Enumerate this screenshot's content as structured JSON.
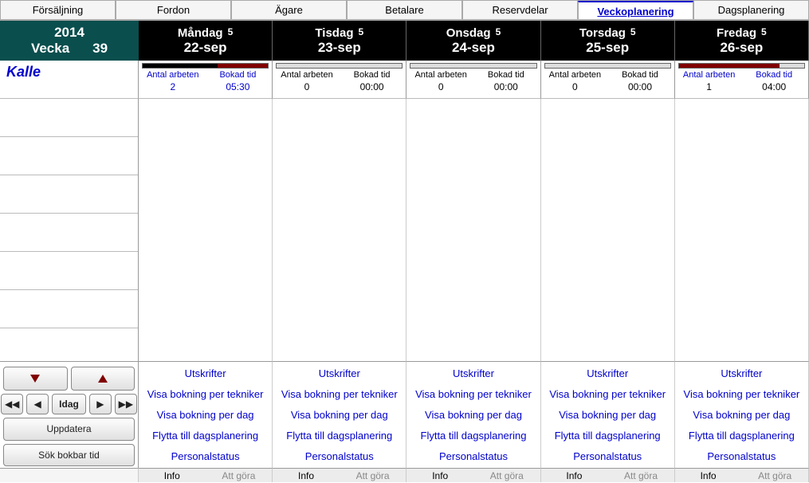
{
  "tabs": {
    "sales": "Försäljning",
    "vehicle": "Fordon",
    "owner": "Ägare",
    "payer": "Betalare",
    "parts": "Reservdelar",
    "week": "Veckoplanering",
    "day": "Dagsplanering"
  },
  "week": {
    "year": "2014",
    "label": "Vecka",
    "num": "39"
  },
  "tech_name": "Kalle",
  "headers": {
    "jobs": "Antal arbeten",
    "booked": "Bokad tid"
  },
  "days": [
    {
      "name": "Måndag",
      "cap": "5",
      "date": "22-sep",
      "jobs": "2",
      "time": "05:30",
      "bar_black": 60,
      "bar_red": 40,
      "highlight": true
    },
    {
      "name": "Tisdag",
      "cap": "5",
      "date": "23-sep",
      "jobs": "0",
      "time": "00:00",
      "bar_black": 0,
      "bar_red": 0,
      "highlight": false
    },
    {
      "name": "Onsdag",
      "cap": "5",
      "date": "24-sep",
      "jobs": "0",
      "time": "00:00",
      "bar_black": 0,
      "bar_red": 0,
      "highlight": false
    },
    {
      "name": "Torsdag",
      "cap": "5",
      "date": "25-sep",
      "jobs": "0",
      "time": "00:00",
      "bar_black": 0,
      "bar_red": 0,
      "highlight": false
    },
    {
      "name": "Fredag",
      "cap": "5",
      "date": "26-sep",
      "jobs": "1",
      "time": "04:00",
      "bar_black": 0,
      "bar_red": 80,
      "highlight": false
    }
  ],
  "nav": {
    "today": "Idag",
    "refresh": "Uppdatera",
    "search": "Sök bokbar tid"
  },
  "menu": {
    "print": "Utskrifter",
    "by_tech": "Visa bokning per tekniker",
    "by_day": "Visa bokning per dag",
    "move_day": "Flytta till dagsplanering",
    "status": "Personalstatus"
  },
  "footer": {
    "info": "Info",
    "todo": "Att göra"
  }
}
